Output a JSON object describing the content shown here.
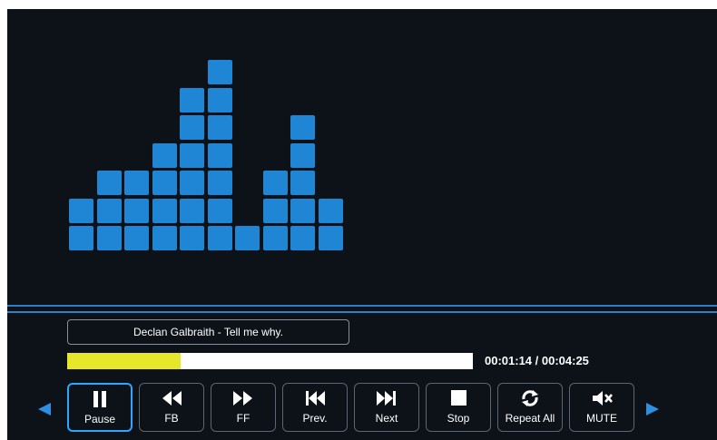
{
  "player": {
    "track_title": "Declan Galbraith - Tell me why.",
    "time_readout": "00:01:14 / 00:04:25",
    "progress_fraction": 0.28,
    "accent_color": "#1f86d6",
    "progress_color": "#e6e62a"
  },
  "equalizer": {
    "levels": [
      2,
      3,
      3,
      4,
      6,
      7,
      1,
      3,
      5,
      2
    ]
  },
  "controls": {
    "buttons": [
      {
        "label": "Pause",
        "icon": "pause-icon"
      },
      {
        "label": "FB",
        "icon": "fast-backward-icon"
      },
      {
        "label": "FF",
        "icon": "fast-forward-icon"
      },
      {
        "label": "Prev.",
        "icon": "previous-track-icon"
      },
      {
        "label": "Next",
        "icon": "next-track-icon"
      },
      {
        "label": "Stop",
        "icon": "stop-icon"
      },
      {
        "label": "Repeat All",
        "icon": "repeat-icon"
      },
      {
        "label": "MUTE",
        "icon": "mute-icon"
      }
    ],
    "selected_index": 0,
    "left_arrow_icon": "left-arrow-icon",
    "right_arrow_icon": "right-arrow-icon"
  }
}
